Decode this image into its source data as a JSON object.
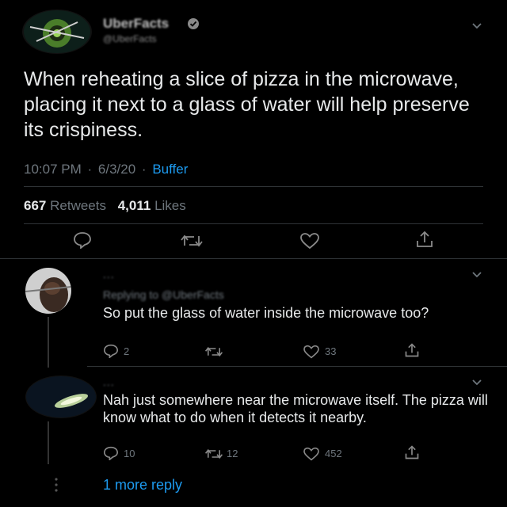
{
  "main_tweet": {
    "author_name": "UberFacts",
    "author_handle": "@UberFacts",
    "text": "When reheating a slice of pizza in the microwave, placing it next to a glass of water will help preserve its crispiness.",
    "time": "10:07 PM",
    "date": "6/3/20",
    "source": "Buffer",
    "sep": "·",
    "retweets_count": "667",
    "retweets_label": "Retweets",
    "likes_count": "4,011",
    "likes_label": "Likes"
  },
  "reply1": {
    "author_line": "...",
    "replying_to": "Replying to @UberFacts",
    "text": "So put the glass of water inside the microwave too?",
    "reply_count": "2",
    "like_count": "33"
  },
  "reply2": {
    "author_line": "...",
    "text": "Nah just somewhere near the microwave itself. The pizza will know what to do when it detects it nearby.",
    "reply_count": "10",
    "retweet_count": "12",
    "like_count": "452"
  },
  "more_replies": "1 more reply",
  "colors": {
    "accent": "#1d9bf0",
    "text": "#d9d9d9",
    "muted": "#6e767d",
    "bg": "#000000"
  },
  "icons": [
    "chevron-down-icon",
    "reply-icon",
    "retweet-icon",
    "like-icon",
    "share-icon",
    "verified-icon"
  ]
}
